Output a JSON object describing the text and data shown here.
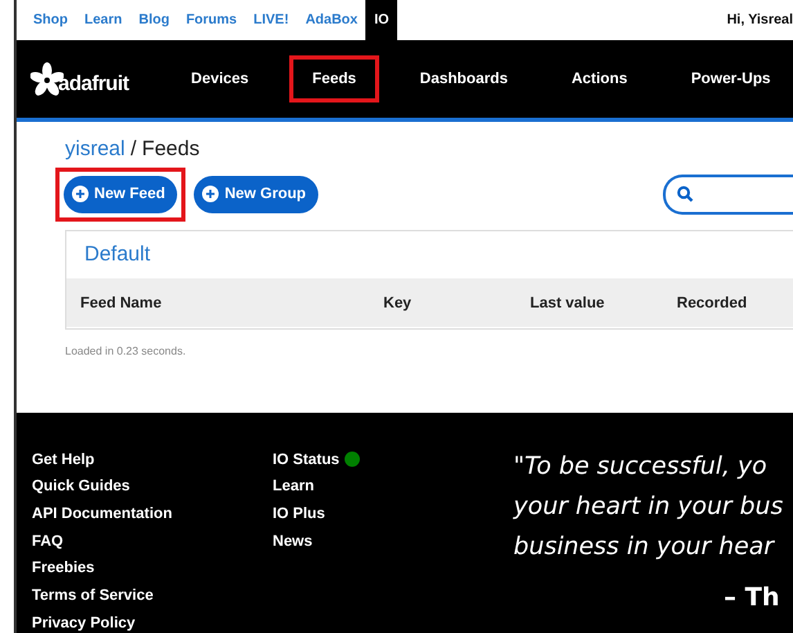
{
  "top_links": [
    {
      "label": "Shop",
      "selected": false
    },
    {
      "label": "Learn",
      "selected": false
    },
    {
      "label": "Blog",
      "selected": false
    },
    {
      "label": "Forums",
      "selected": false
    },
    {
      "label": "LIVE!",
      "selected": false
    },
    {
      "label": "AdaBox",
      "selected": false
    },
    {
      "label": "IO",
      "selected": true
    }
  ],
  "greeting": "Hi, Yisreal",
  "logo": "adafruit",
  "nav": [
    {
      "label": "Devices",
      "annotated": false
    },
    {
      "label": "Feeds",
      "annotated": true
    },
    {
      "label": "Dashboards",
      "annotated": false
    },
    {
      "label": "Actions",
      "annotated": false
    },
    {
      "label": "Power-Ups",
      "annotated": false
    }
  ],
  "breadcrumb": {
    "user": "yisreal",
    "separator": "/",
    "page": "Feeds"
  },
  "buttons": [
    {
      "label": "New Feed",
      "annotated": true
    },
    {
      "label": "New Group",
      "annotated": false
    }
  ],
  "group": {
    "title": "Default",
    "columns": [
      "Feed Name",
      "Key",
      "Last value",
      "Recorded"
    ]
  },
  "load_time": "Loaded in 0.23 seconds.",
  "footer": {
    "column_1": [
      {
        "label": "Get Help"
      },
      {
        "label": "Quick Guides"
      },
      {
        "label": "API Documentation"
      },
      {
        "label": "FAQ"
      },
      {
        "label": "Freebies"
      },
      {
        "label": "Terms of Service"
      },
      {
        "label": "Privacy Policy"
      }
    ],
    "column_2": [
      {
        "label": "IO Status",
        "color": "#008000"
      },
      {
        "label": "Learn"
      },
      {
        "label": "IO Plus"
      },
      {
        "label": "News"
      }
    ],
    "quote_lines": [
      "\"To be successful, yo",
      "your heart in your bus",
      "business in your hear"
    ],
    "attribution": "– Th"
  }
}
